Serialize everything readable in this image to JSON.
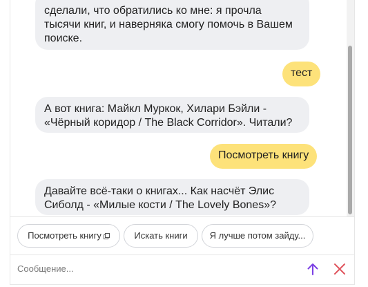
{
  "messages": [
    {
      "from": "bot",
      "lines": [
        "сделали, что обратились ко мне: я прочла",
        "тысячи книг, и наверняка смогу помочь в Вашем",
        "поиске."
      ]
    },
    {
      "from": "user",
      "text": "тест"
    },
    {
      "from": "bot",
      "lines": [
        "А вот книга: Майкл Муркок, Хилари Бэйли -",
        "«Чёрный коридор / The Black Corridor». Читали?"
      ]
    },
    {
      "from": "user",
      "text": "Посмотреть книгу"
    },
    {
      "from": "bot",
      "lines": [
        "Давайте всё-таки о книгах... Как насчёт Элис",
        "Сиболд - «Милые кости / The Lovely Bones»?"
      ]
    }
  ],
  "suggestions": [
    {
      "label": "Посмотреть книгу",
      "icon": "external-link-icon"
    },
    {
      "label": "Искать книги"
    },
    {
      "label": "Я лучше потом зайду..."
    }
  ],
  "input": {
    "placeholder": "Сообщение...",
    "value": ""
  },
  "icons": {
    "send": "arrow-up-icon",
    "close": "close-icon"
  },
  "colors": {
    "bot_bubble": "#eeeff2",
    "user_bubble": "#fde27a",
    "send_icon": "#7b3fe4",
    "close_icon": "#e0555e"
  }
}
